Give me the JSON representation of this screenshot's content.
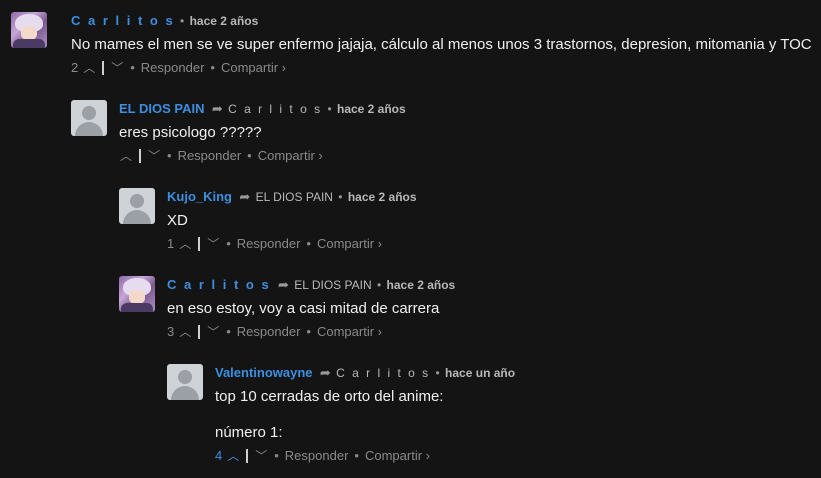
{
  "comments": [
    {
      "author": "C a r l i t o s",
      "reply_to": "",
      "time": "hace 2 años",
      "text": "No mames el men se ve super enfermo jajaja, cálculo al menos unos 3 trastornos, depresion, mitomania y TOC",
      "votes": "2",
      "avatar": "anime"
    },
    {
      "author": "EL DIOS PAIN",
      "reply_to": "C a r l i t o s",
      "time": "hace 2 años",
      "text": "eres psicologo ?????",
      "votes": "",
      "avatar": "default"
    },
    {
      "author": "Kujo_King",
      "reply_to": "EL DIOS PAIN",
      "time": "hace 2 años",
      "text": "XD",
      "votes": "1",
      "avatar": "default"
    },
    {
      "author": "C a r l i t o s",
      "reply_to": "EL DIOS PAIN",
      "time": "hace 2 años",
      "text": "en eso estoy, voy a casi mitad de carrera",
      "votes": "3",
      "avatar": "anime"
    },
    {
      "author": "Valentinowayne",
      "reply_to": "C a r l i t o s",
      "time": "hace un año",
      "text": "top 10 cerradas de orto del anime:",
      "text2": "número 1:",
      "votes": "4",
      "avatar": "default"
    }
  ],
  "labels": {
    "bullet": "•",
    "reply": "Responder",
    "share": "Compartir ›",
    "upvote_icon": "chevron-up",
    "downvote_icon": "chevron-down",
    "reply_arrow_icon": "reply-arrow"
  },
  "colors": {
    "background": "#141414",
    "author": "#3b8fe0",
    "text": "#f0f0f0",
    "muted": "#8a8a8a"
  }
}
